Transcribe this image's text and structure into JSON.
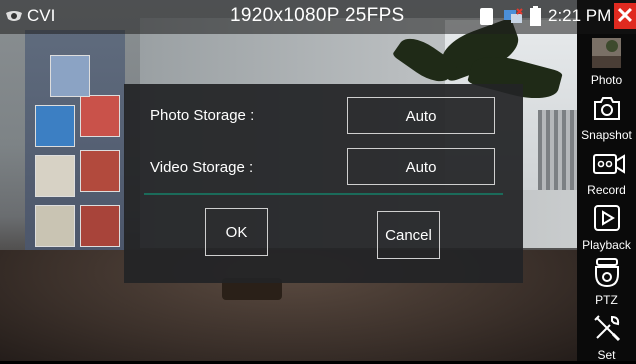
{
  "statusbar": {
    "app_label": "CVI",
    "resolution": "1920x1080P 25FPS",
    "time": "2:21 PM"
  },
  "sidebar": {
    "items": [
      {
        "label": "Photo",
        "icon": "photo-thumbnail-icon"
      },
      {
        "label": "Snapshot",
        "icon": "camera-icon"
      },
      {
        "label": "Record",
        "icon": "video-record-icon"
      },
      {
        "label": "Playback",
        "icon": "play-icon"
      },
      {
        "label": "PTZ",
        "icon": "ptz-camera-icon"
      },
      {
        "label": "Set",
        "icon": "tools-icon"
      }
    ]
  },
  "dialog": {
    "photo_storage_label": "Photo Storage :",
    "photo_storage_value": "Auto",
    "video_storage_label": "Video Storage :",
    "video_storage_value": "Auto",
    "ok_label": "OK",
    "cancel_label": "Cancel"
  },
  "colors": {
    "close_button": "#e02a20",
    "divider": "#1b6b5a"
  }
}
